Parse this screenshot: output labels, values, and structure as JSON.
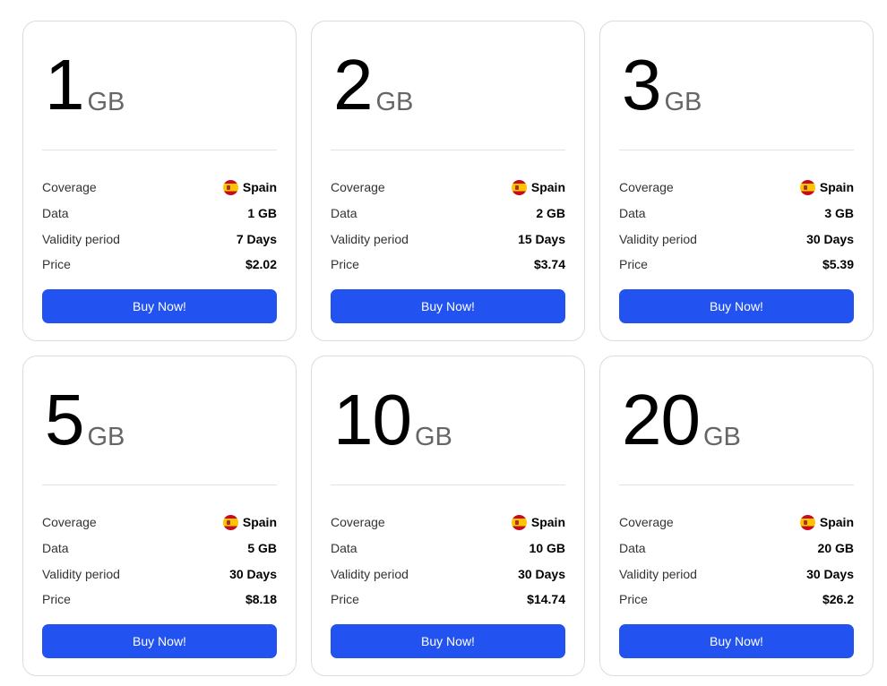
{
  "labels": {
    "coverage": "Coverage",
    "data": "Data",
    "validity": "Validity period",
    "price": "Price",
    "buy": "Buy Now!"
  },
  "plans": [
    {
      "amount": "1",
      "unit": "GB",
      "coverage": "Spain",
      "data": "1 GB",
      "validity": "7 Days",
      "price": "$2.02"
    },
    {
      "amount": "2",
      "unit": "GB",
      "coverage": "Spain",
      "data": "2 GB",
      "validity": "15 Days",
      "price": "$3.74"
    },
    {
      "amount": "3",
      "unit": "GB",
      "coverage": "Spain",
      "data": "3 GB",
      "validity": "30 Days",
      "price": "$5.39"
    },
    {
      "amount": "5",
      "unit": "GB",
      "coverage": "Spain",
      "data": "5 GB",
      "validity": "30 Days",
      "price": "$8.18"
    },
    {
      "amount": "10",
      "unit": "GB",
      "coverage": "Spain",
      "data": "10 GB",
      "validity": "30 Days",
      "price": "$14.74"
    },
    {
      "amount": "20",
      "unit": "GB",
      "coverage": "Spain",
      "data": "20 GB",
      "validity": "30 Days",
      "price": "$26.2"
    }
  ],
  "icons": {
    "flag": "spain-flag-icon"
  },
  "colors": {
    "button": "#2253f0",
    "unit": "#666666",
    "border": "#dcdcdc"
  }
}
